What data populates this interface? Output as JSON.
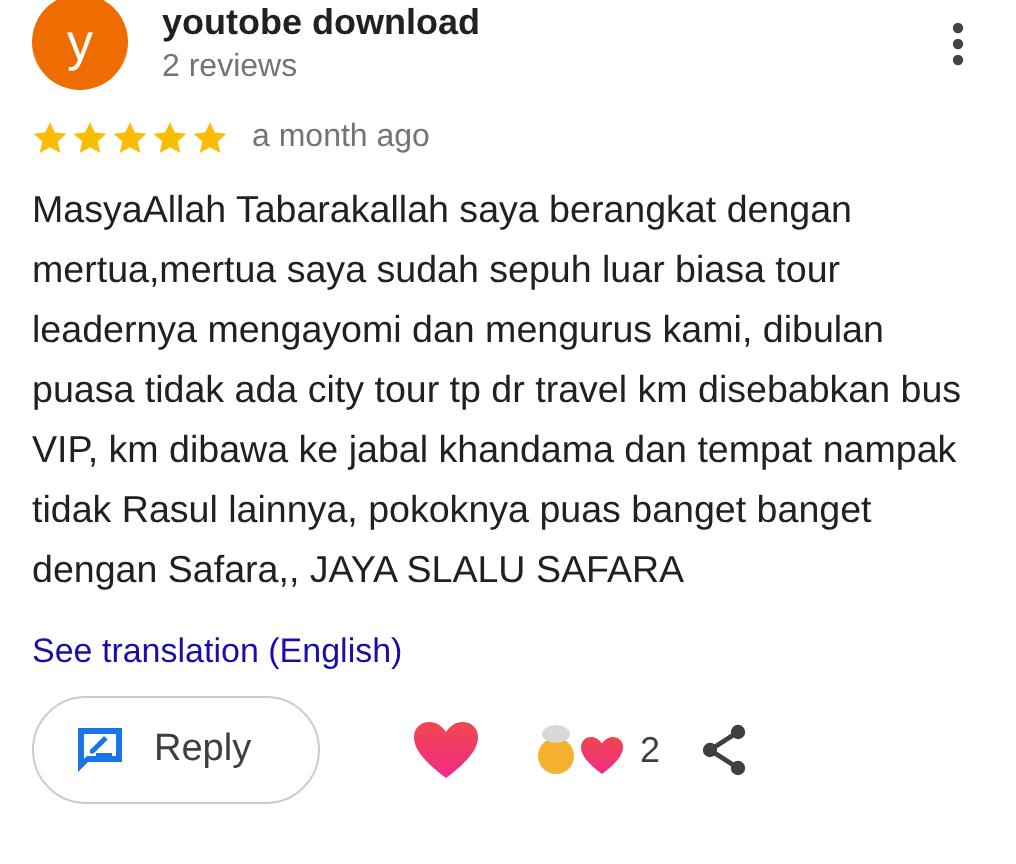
{
  "author": {
    "initial": "y",
    "name": "youtobe download",
    "reviews": "2 reviews"
  },
  "rating": {
    "stars": 5,
    "time": "a month ago"
  },
  "review_text": "MasyaAllah Tabarakallah saya berangkat dengan mertua,mertua saya sudah sepuh luar biasa tour leadernya mengayomi dan mengurus kami, dibulan puasa tidak ada city tour tp dr travel km disebabkan bus VIP, km dibawa ke jabal khandama dan tempat nampak tidak Rasul lainnya, pokoknya puas banget banget dengan Safara,, JAYA SLALU SAFARA",
  "translation_link": "See translation (English)",
  "actions": {
    "reply": "Reply",
    "reaction_count": "2"
  }
}
